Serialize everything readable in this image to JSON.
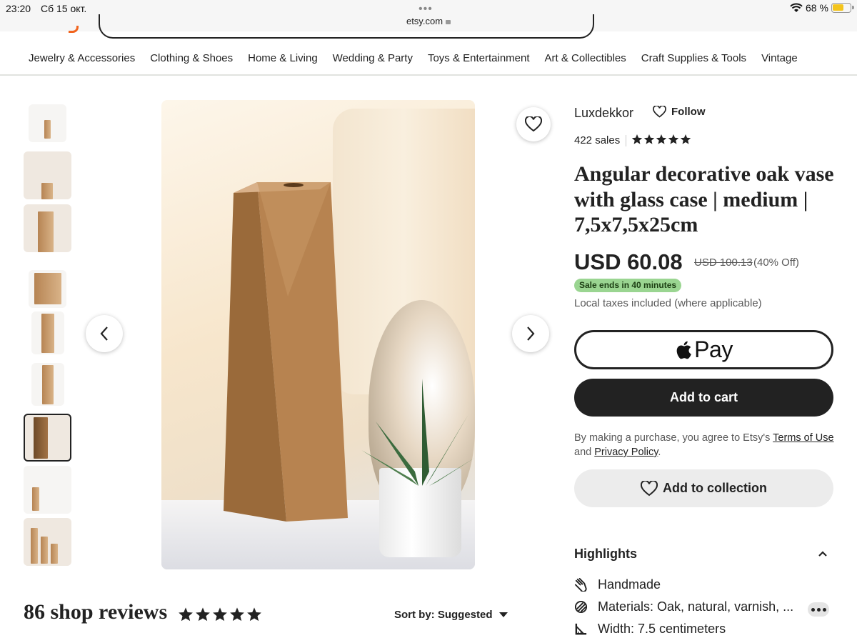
{
  "status_bar": {
    "time": "23:20",
    "date": "Сб 15 окт.",
    "url": "etsy.com",
    "battery_percent": "68 %",
    "battery_level": 0.68
  },
  "categories": [
    "Jewelry & Accessories",
    "Clothing & Shoes",
    "Home & Living",
    "Wedding & Party",
    "Toys & Entertainment",
    "Art & Collectibles",
    "Craft Supplies & Tools",
    "Vintage"
  ],
  "gallery": {
    "thumbnail_count": 9,
    "selected_index": 6
  },
  "listing": {
    "shop_name": "Luxdekkor",
    "follow_label": "Follow",
    "sales": "422 sales",
    "rating_stars": 5,
    "title": "Angular decorative oak vase with glass case | medium | 7,5x7,5x25cm",
    "price": "USD 60.08",
    "original_price": "USD 100.13",
    "discount": "(40% Off)",
    "sale_badge": "Sale ends in 40 minutes",
    "taxes_note": "Local taxes included (where applicable)",
    "apple_pay_label": "Pay",
    "add_to_cart_label": "Add to cart",
    "legal_prefix": "By making a purchase, you agree to Etsy's",
    "terms_link": "Terms of Use",
    "legal_and": "and",
    "privacy_link": "Privacy Policy",
    "legal_suffix": ".",
    "add_to_collection_label": "Add to collection"
  },
  "highlights": {
    "title": "Highlights",
    "items": [
      {
        "icon": "hand-icon",
        "text": "Handmade"
      },
      {
        "icon": "materials-icon",
        "text": "Materials: Oak, natural, varnish, ..."
      },
      {
        "icon": "ruler-icon",
        "text": "Width: 7.5 centimeters"
      }
    ]
  },
  "reviews": {
    "title": "86 shop reviews",
    "stars": 5,
    "sort_label": "Sort by: Suggested"
  },
  "colors": {
    "accent": "#f1641e",
    "sale_green": "#9ad591",
    "button_dark": "#222222"
  }
}
